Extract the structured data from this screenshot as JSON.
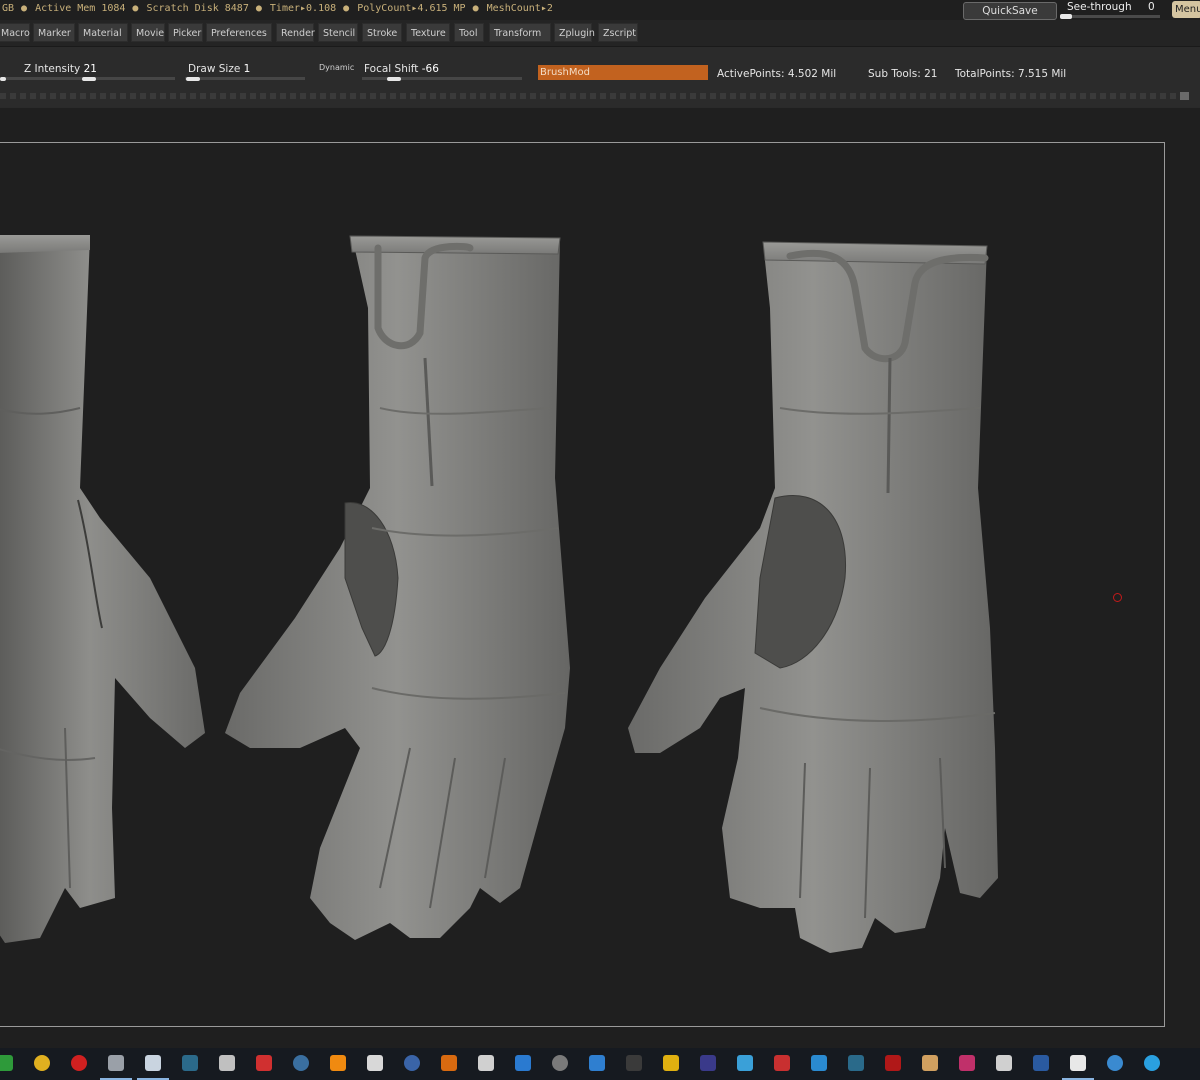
{
  "topbar": {
    "stats": [
      "GB",
      "Active Mem 1084",
      "Scratch Disk 8487",
      "Timer▸0.108",
      "PolyCount▸4.615 MP",
      "MeshCount▸2"
    ],
    "quicksave": "QuickSave",
    "see_through_label": "See-through",
    "see_through_value": "0",
    "menus_label": "Menus"
  },
  "menubar": [
    "Macro",
    "Marker",
    "Material",
    "Movie",
    "Picker",
    "Preferences",
    "Render",
    "Stencil",
    "Stroke",
    "Texture",
    "Tool",
    "Transform",
    "Zplugin",
    "Zscript"
  ],
  "toolbar": {
    "z_intensity_label": "Z Intensity",
    "z_intensity_value": "21",
    "draw_size_label": "Draw Size",
    "draw_size_value": "1",
    "dynamic_label": "Dynamic",
    "focal_shift_label": "Focal Shift",
    "focal_shift_value": "-66",
    "brushmod_label": "BrushMod",
    "active_points": "ActivePoints: 4.502 Mil",
    "sub_tools": "Sub Tools: 21",
    "total_points": "TotalPoints: 7.515 Mil"
  },
  "colors": {
    "stats_text": "#c8b07a",
    "brushmod_accent": "#c2621f",
    "viewport_bg": "#1f1f1f",
    "mesh_gray": "#8a8a88"
  },
  "taskbar_icons": [
    {
      "name": "app-green-icon",
      "color": "#2e9a3a"
    },
    {
      "name": "chrome-icon",
      "color": "#e0b020"
    },
    {
      "name": "record-icon",
      "color": "#d02020"
    },
    {
      "name": "settings-app-icon",
      "color": "#9aa0a8"
    },
    {
      "name": "explorer-icon",
      "color": "#c9d4e0"
    },
    {
      "name": "blender-icon",
      "color": "#2b6a8a"
    },
    {
      "name": "pinwheel-icon",
      "color": "#c0c0c0"
    },
    {
      "name": "stop-sign-icon",
      "color": "#d03030"
    },
    {
      "name": "steam-icon",
      "color": "#3a6fa0"
    },
    {
      "name": "vlc-icon",
      "color": "#f08a10"
    },
    {
      "name": "bluetooth-keys-icon",
      "color": "#d8d8d8"
    },
    {
      "name": "globe-icon",
      "color": "#3a64a8"
    },
    {
      "name": "app-orange-icon",
      "color": "#d86a10"
    },
    {
      "name": "unity-icon",
      "color": "#d0d0d0"
    },
    {
      "name": "sourcetree-icon",
      "color": "#2a7ad0"
    },
    {
      "name": "obs-icon",
      "color": "#7a7a7a"
    },
    {
      "name": "vscode-icon",
      "color": "#2f7fd0"
    },
    {
      "name": "k-app-icon",
      "color": "#3a3a3a"
    },
    {
      "name": "marmoset-icon",
      "color": "#e0b010"
    },
    {
      "name": "after-effects-icon",
      "color": "#3a3a8a"
    },
    {
      "name": "flask-icon",
      "color": "#3aa0d8"
    },
    {
      "name": "stop-red-icon",
      "color": "#c83030"
    },
    {
      "name": "refresh-app-icon",
      "color": "#2a8ad0"
    },
    {
      "name": "zbrush-icon",
      "color": "#2a6a8a"
    },
    {
      "name": "substance-icon",
      "color": "#b01818"
    },
    {
      "name": "photo-app-icon",
      "color": "#d0a060"
    },
    {
      "name": "indesign-icon",
      "color": "#c0306a"
    },
    {
      "name": "unity-dark-icon",
      "color": "#d0d0d0"
    },
    {
      "name": "monitor-app-icon",
      "color": "#2a5aa0"
    },
    {
      "name": "notepad-icon",
      "color": "#e8e8e8"
    },
    {
      "name": "network-globe-icon",
      "color": "#3a8ad0"
    },
    {
      "name": "skype-icon",
      "color": "#2aa0e0"
    }
  ]
}
